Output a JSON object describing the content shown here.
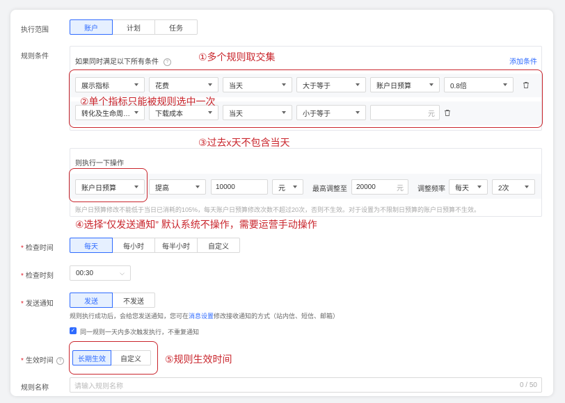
{
  "scope": {
    "label": "执行范围",
    "options": [
      "账户",
      "计划",
      "任务"
    ],
    "active": 0
  },
  "conditions": {
    "label": "规则条件",
    "header": "如果同时满足以下所有条件",
    "add_label": "添加条件",
    "rows": [
      {
        "metric": "展示指标",
        "item": "花费",
        "period": "当天",
        "op": "大于等于",
        "target": "账户日预算",
        "value": "0.8倍"
      },
      {
        "metric": "转化及生命周…",
        "item": "下载成本",
        "period": "当天",
        "op": "小于等于",
        "target": "",
        "value_unit": "元"
      }
    ]
  },
  "action": {
    "title": "则执行一下操作",
    "type": "账户日预算",
    "direction": "提高",
    "amount": "10000",
    "unit": "元",
    "max_label": "最高调整至",
    "max_value": "20000",
    "max_unit": "元",
    "freq_label": "调整频率",
    "freq_period": "每天",
    "freq_count": "2次",
    "note": "账户日预算修改不能低于当日已消耗的105%，每天账户日预算修改次数不超过20次，否则不生效。对于设置为不限制日预算的账户日预算不生效。"
  },
  "check_time": {
    "label": "检查时间",
    "options": [
      "每天",
      "每小时",
      "每半小时",
      "自定义"
    ],
    "active": 0
  },
  "check_moment": {
    "label": "检查时刻",
    "value": "00:30"
  },
  "notify": {
    "label": "发送通知",
    "options": [
      "发送",
      "不发送"
    ],
    "active": 0,
    "hint_pre": "规则执行成功后，会给您发送通知，您可在",
    "hint_link": "消息设置",
    "hint_post": "修改接收通知的方式（站内信、短信、邮箱）",
    "repeat_label": "同一规则一天内多次触发执行，不重复通知"
  },
  "effective": {
    "label": "生效时间",
    "options": [
      "长期生效",
      "自定义"
    ],
    "active": 0
  },
  "rule_name": {
    "label": "规则名称",
    "placeholder": "请输入规则名称",
    "counter": "0 / 50"
  },
  "annotations": {
    "a1": "①多个规则取交集",
    "a2": "②单个指标只能被规则选中一次",
    "a3": "③过去x天不包含当天",
    "a4": "④选择“仅发送通知” 默认系统不操作，需要运营手动操作",
    "a5": "⑤规则生效时间"
  },
  "colors": {
    "accent": "#2f6bff",
    "annotation": "#c9252c",
    "required": "#e0202b"
  }
}
